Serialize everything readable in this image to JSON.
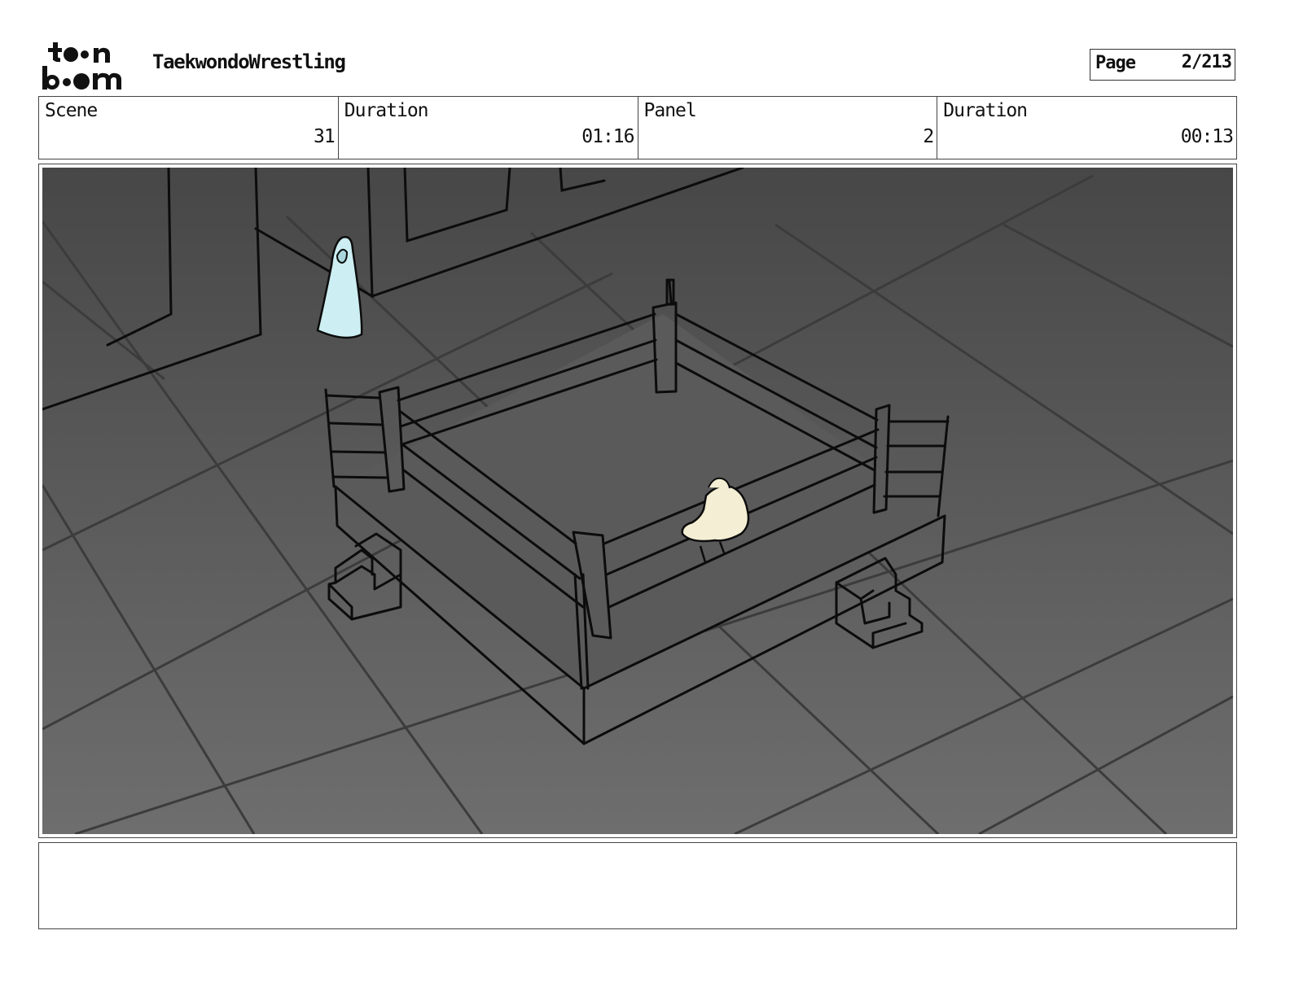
{
  "header": {
    "logo_text": "toon boom",
    "project_title": "TaekwondoWrestling",
    "page_label": "Page",
    "page_value": "2/213"
  },
  "info": {
    "scene_label": "Scene",
    "scene_value": "31",
    "scene_duration_label": "Duration",
    "scene_duration_value": "01:16",
    "panel_label": "Panel",
    "panel_value": "2",
    "panel_duration_label": "Duration",
    "panel_duration_value": "00:13"
  },
  "notes": {
    "text": ""
  },
  "colors": {
    "background_dark": "#474747",
    "background_light": "#6e6e6e",
    "line": "#0c0c0c",
    "ghost_fill": "#cdeef2",
    "fighter_fill": "#f4efd4"
  }
}
